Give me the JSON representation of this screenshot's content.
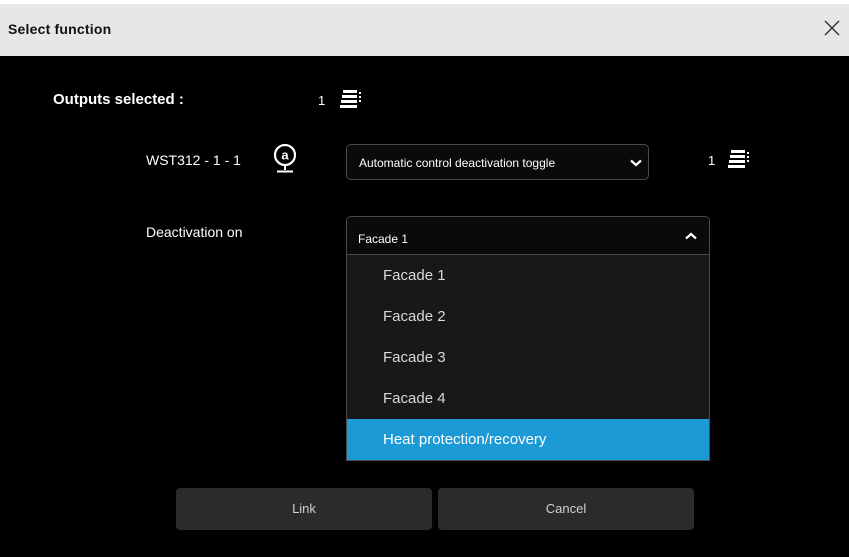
{
  "dialog": {
    "title": "Select function",
    "close_icon": "close-icon"
  },
  "outputs": {
    "label": "Outputs selected :",
    "count": "1",
    "icon": "stack-icon"
  },
  "device": {
    "label": "WST312 - 1 - 1",
    "icon": "automatic-mode-icon",
    "function_select": {
      "value": "Automatic control deactivation toggle",
      "icon": "chevron-down-icon"
    },
    "count": "1",
    "count_icon": "stack-icon"
  },
  "deactivation": {
    "label": "Deactivation on",
    "select": {
      "value": "Facade 1",
      "icon": "chevron-up-icon"
    },
    "options": [
      "Facade 1",
      "Facade 2",
      "Facade 3",
      "Facade 4",
      "Heat protection/recovery"
    ],
    "highlighted_option": "Heat protection/recovery"
  },
  "buttons": {
    "link_label": "Link",
    "cancel_label": "Cancel"
  },
  "colors": {
    "titlebar_bg": "#e7e7e7",
    "dialog_bg": "#000000",
    "highlight": "#1c9ad6",
    "button_bg": "#2b2b2b"
  }
}
